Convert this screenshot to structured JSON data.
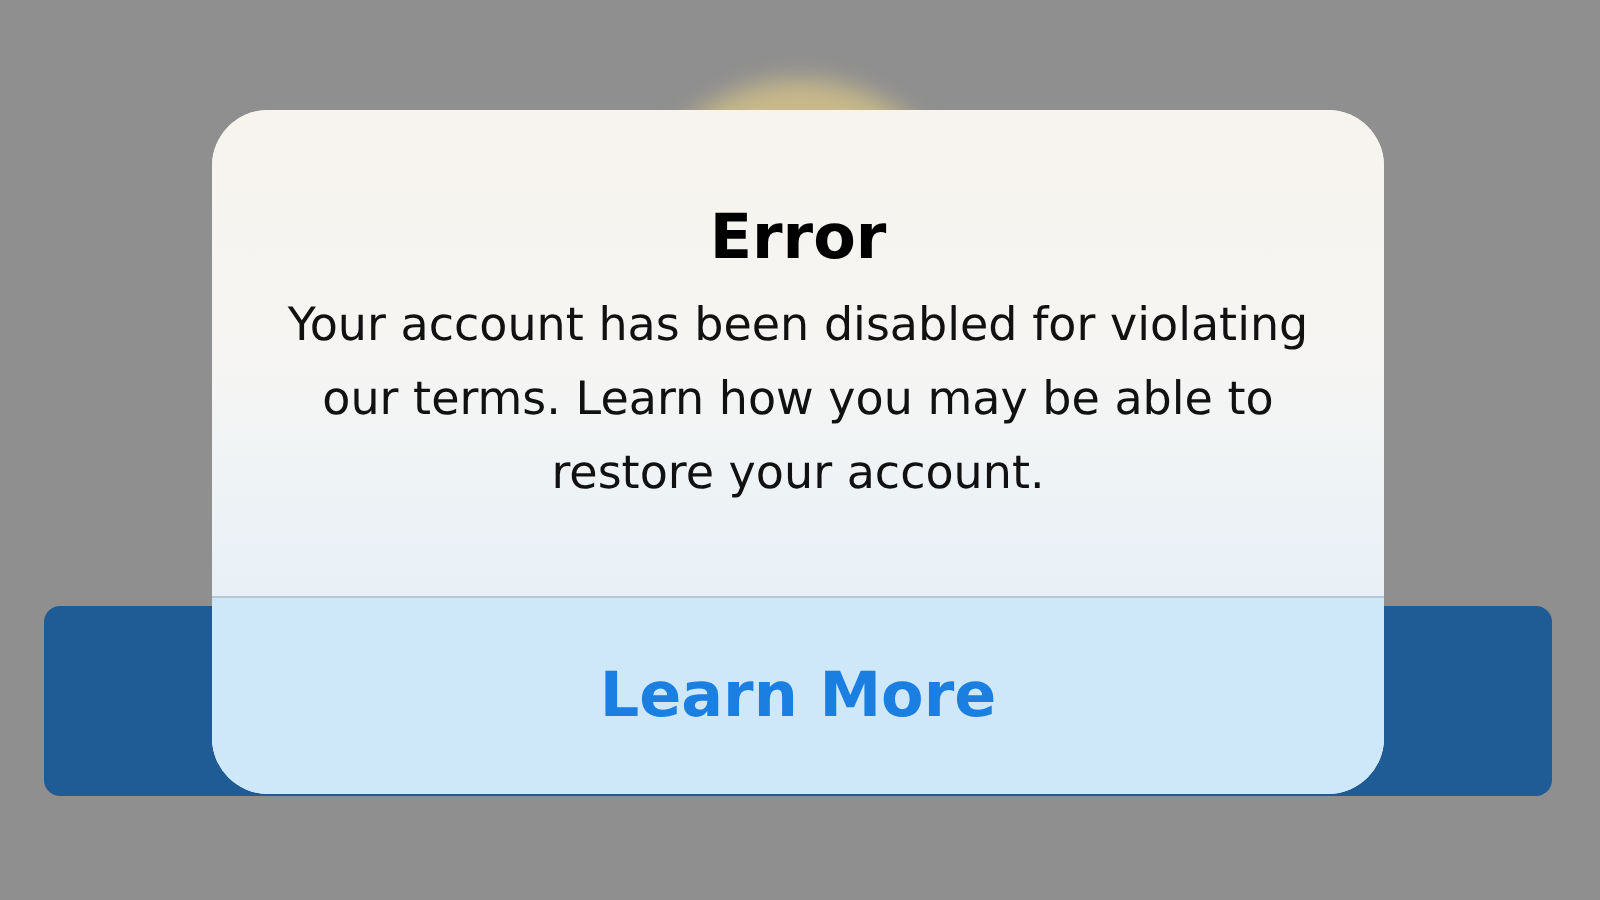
{
  "alert": {
    "title": "Error",
    "message": "Your account has been disabled for violating our terms. Learn how you may be able to restore your account.",
    "button": "Learn More"
  }
}
